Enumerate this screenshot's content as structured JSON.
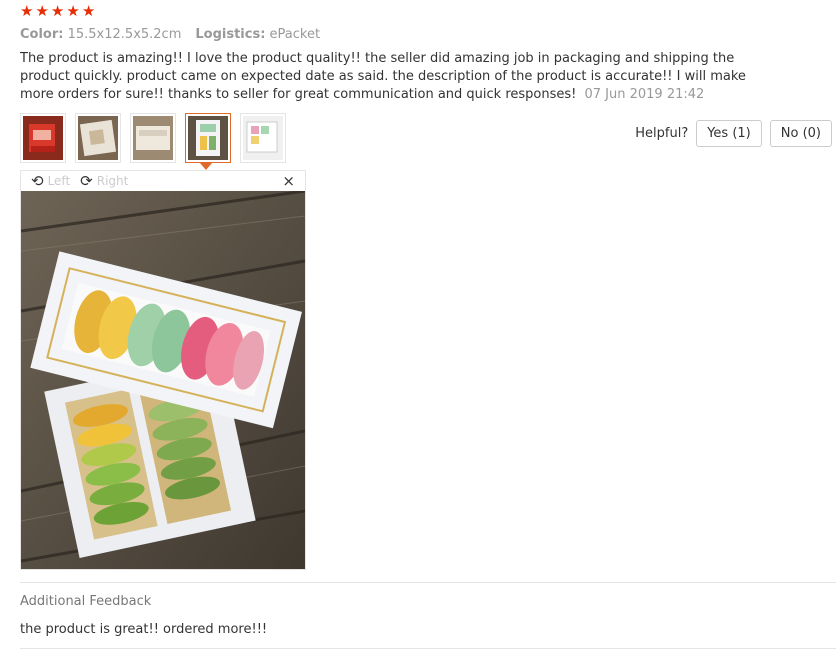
{
  "review": {
    "rating": 5,
    "color_label": "Color:",
    "color_value": "15.5x12.5x5.2cm",
    "logistics_label": "Logistics:",
    "logistics_value": "ePacket",
    "text": "The product is amazing!! I love the product quality!! the seller did amazing job in packaging and shipping the product quickly. product came on expected date as said. the description of the product is accurate!! I will make more orders for sure!! thanks to seller for great communication and quick responses!",
    "date": "07 Jun 2019 21:42"
  },
  "helpful": {
    "label": "Helpful?",
    "yes_label": "Yes (1)",
    "no_label": "No (0)"
  },
  "viewer": {
    "rotate_left_label": "Left",
    "rotate_right_label": "Right",
    "close_symbol": "×",
    "selected_thumbnail": 4
  },
  "icons": {
    "star": "star-icon",
    "rotate_left": "rotate-left-icon",
    "rotate_right": "rotate-right-icon",
    "close": "close-icon"
  },
  "colors": {
    "star": "#e62e04",
    "active_thumb_border": "#e06a2a"
  },
  "additional": {
    "title": "Additional Feedback",
    "text": "the product is great!! ordered more!!!"
  }
}
